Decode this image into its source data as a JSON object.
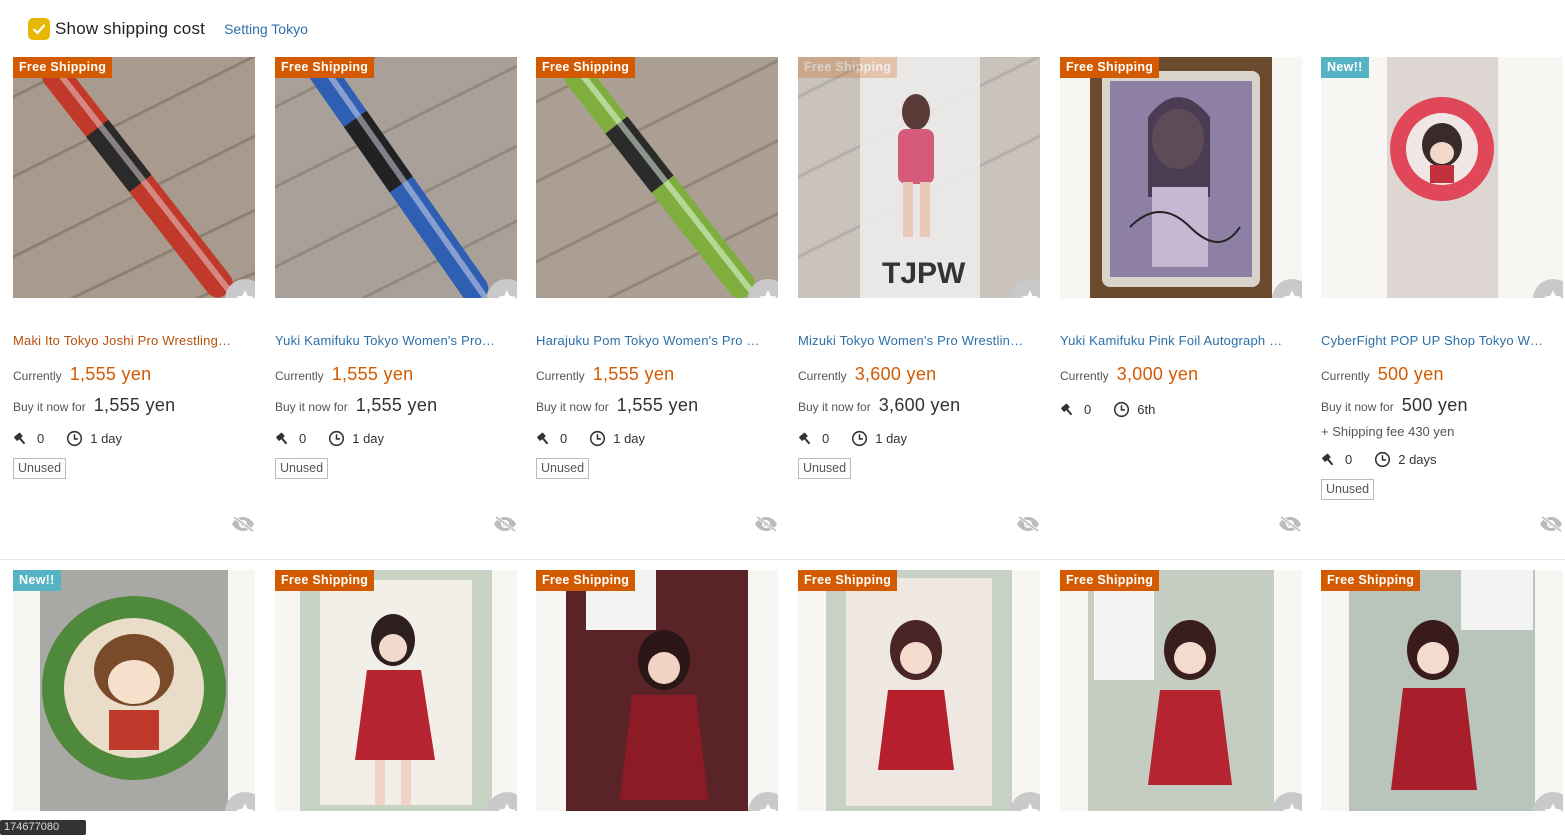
{
  "header": {
    "show_shipping_label": "Show shipping cost",
    "show_shipping_checked": true,
    "setting_link": "Setting Tokyo"
  },
  "labels": {
    "currently": "Currently",
    "buy_now": "Buy it now for",
    "unused": "Unused"
  },
  "colors": {
    "accent": "#d45a00",
    "link": "#2d6fa8",
    "checkbox": "#e6b800",
    "new_badge": "#56b3c4"
  },
  "row1": [
    {
      "badge": "Free Shipping",
      "title": "Maki Ito Tokyo Joshi Pro Wrestling…",
      "current": "1,555 yen",
      "buy_now": "1,555 yen",
      "bids": "0",
      "time": "1 day",
      "condition": "Unused"
    },
    {
      "badge": "Free Shipping",
      "title": "Yuki Kamifuku Tokyo Women's Pro…",
      "current": "1,555 yen",
      "buy_now": "1,555 yen",
      "bids": "0",
      "time": "1 day",
      "condition": "Unused"
    },
    {
      "badge": "Free Shipping",
      "title": "Harajuku Pom Tokyo Women's Pro …",
      "current": "1,555 yen",
      "buy_now": "1,555 yen",
      "bids": "0",
      "time": "1 day",
      "condition": "Unused"
    },
    {
      "badge": "Free Shipping",
      "title": "Mizuki Tokyo Women's Pro Wrestlin…",
      "current": "3,600 yen",
      "buy_now": "3,600 yen",
      "bids": "0",
      "time": "1 day",
      "condition": "Unused"
    },
    {
      "badge": "Free Shipping",
      "title": "Yuki Kamifuku Pink Foil Autograph …",
      "current": "3,000 yen",
      "bids": "0",
      "time": "6th"
    },
    {
      "badge": "New!!",
      "title": "CyberFight POP UP Shop Tokyo W…",
      "current": "500 yen",
      "buy_now": "500 yen",
      "shipping_fee": "+ Shipping fee 430 yen",
      "bids": "0",
      "time": "2 days",
      "condition": "Unused"
    }
  ],
  "row2": [
    {
      "badge": "New!!"
    },
    {
      "badge": "Free Shipping"
    },
    {
      "badge": "Free Shipping"
    },
    {
      "badge": "Free Shipping"
    },
    {
      "badge": "Free Shipping"
    },
    {
      "badge": "Free Shipping"
    }
  ],
  "tooltip": "174677080"
}
